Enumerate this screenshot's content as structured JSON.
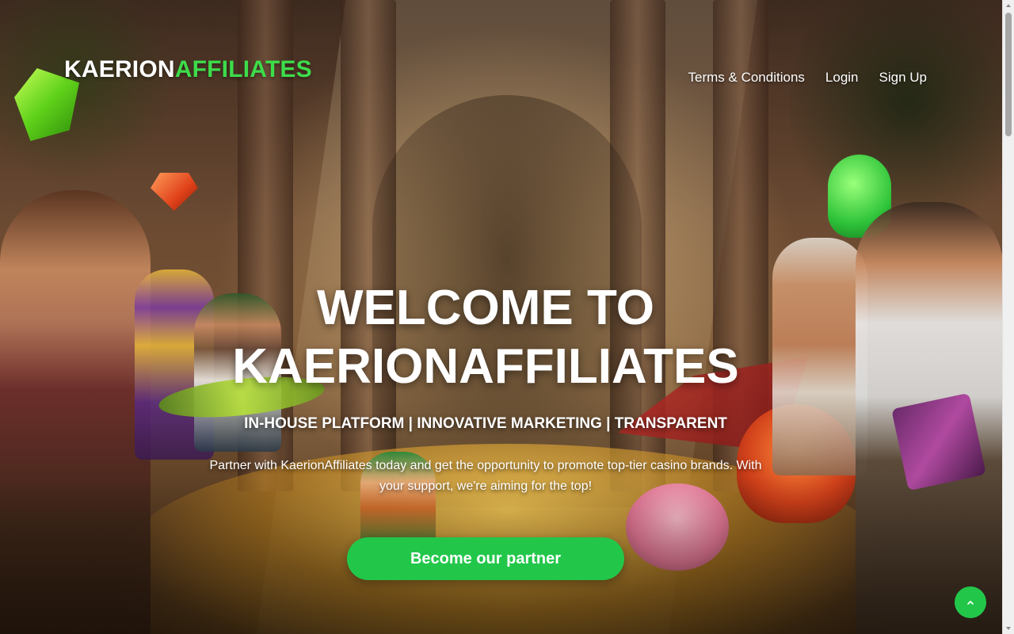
{
  "header": {
    "logo_primary": "KAERION",
    "logo_accent": "AFFILIATES",
    "nav": [
      {
        "label": "Terms & Conditions"
      },
      {
        "label": "Login"
      },
      {
        "label": "Sign Up"
      }
    ]
  },
  "hero": {
    "headline_line1": "WELCOME TO",
    "headline_line2": "KAERIONAFFILIATES",
    "tagline": "IN-HOUSE PLATFORM | INNOVATIVE MARKETING | TRANSPARENT",
    "description": "Partner with KaerionAffiliates today and get the opportunity to promote top-tier casino brands. With your support, we're aiming for the top!",
    "cta_label": "Become our partner"
  },
  "colors": {
    "accent": "#22c74a",
    "logo_accent": "#3ddc4a",
    "text": "#ffffff"
  },
  "icons": {
    "scroll_to_top": "chevron-up-icon"
  }
}
